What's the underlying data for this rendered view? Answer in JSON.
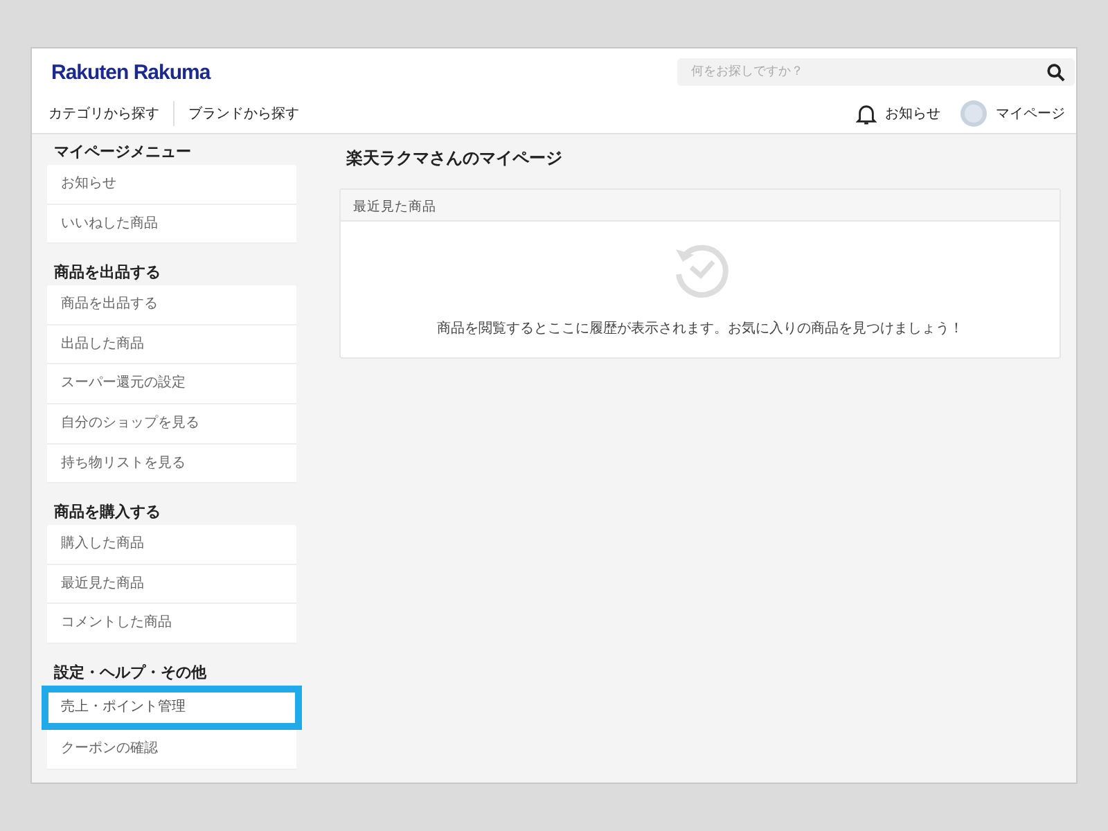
{
  "header": {
    "logo": "Rakuten Rakuma",
    "search": {
      "placeholder": "何をお探しですか？"
    },
    "nav": [
      "カテゴリから探す",
      "ブランドから探す"
    ],
    "notifications": "お知らせ",
    "mypage": "マイページ"
  },
  "sidebar": [
    {
      "title": "マイページメニュー",
      "items": [
        {
          "label": "お知らせ",
          "highlighted": false
        },
        {
          "label": "いいねした商品",
          "highlighted": false
        }
      ]
    },
    {
      "title": "商品を出品する",
      "items": [
        {
          "label": "商品を出品する",
          "highlighted": false
        },
        {
          "label": "出品した商品",
          "highlighted": false
        },
        {
          "label": "スーパー還元の設定",
          "highlighted": false
        },
        {
          "label": "自分のショップを見る",
          "highlighted": false
        },
        {
          "label": "持ち物リストを見る",
          "highlighted": false
        }
      ]
    },
    {
      "title": "商品を購入する",
      "items": [
        {
          "label": "購入した商品",
          "highlighted": false
        },
        {
          "label": "最近見た商品",
          "highlighted": false
        },
        {
          "label": "コメントした商品",
          "highlighted": false
        }
      ]
    },
    {
      "title": "設定・ヘルプ・その他",
      "items": [
        {
          "label": "売上・ポイント管理",
          "highlighted": true
        },
        {
          "label": "クーポンの確認",
          "highlighted": false
        }
      ]
    }
  ],
  "main": {
    "title": "楽天ラクマさんのマイページ",
    "panel": {
      "title": "最近見た商品",
      "message": "商品を閲覧するとここに履歴が表示されます。お気に入りの商品を見つけましょう！"
    }
  }
}
